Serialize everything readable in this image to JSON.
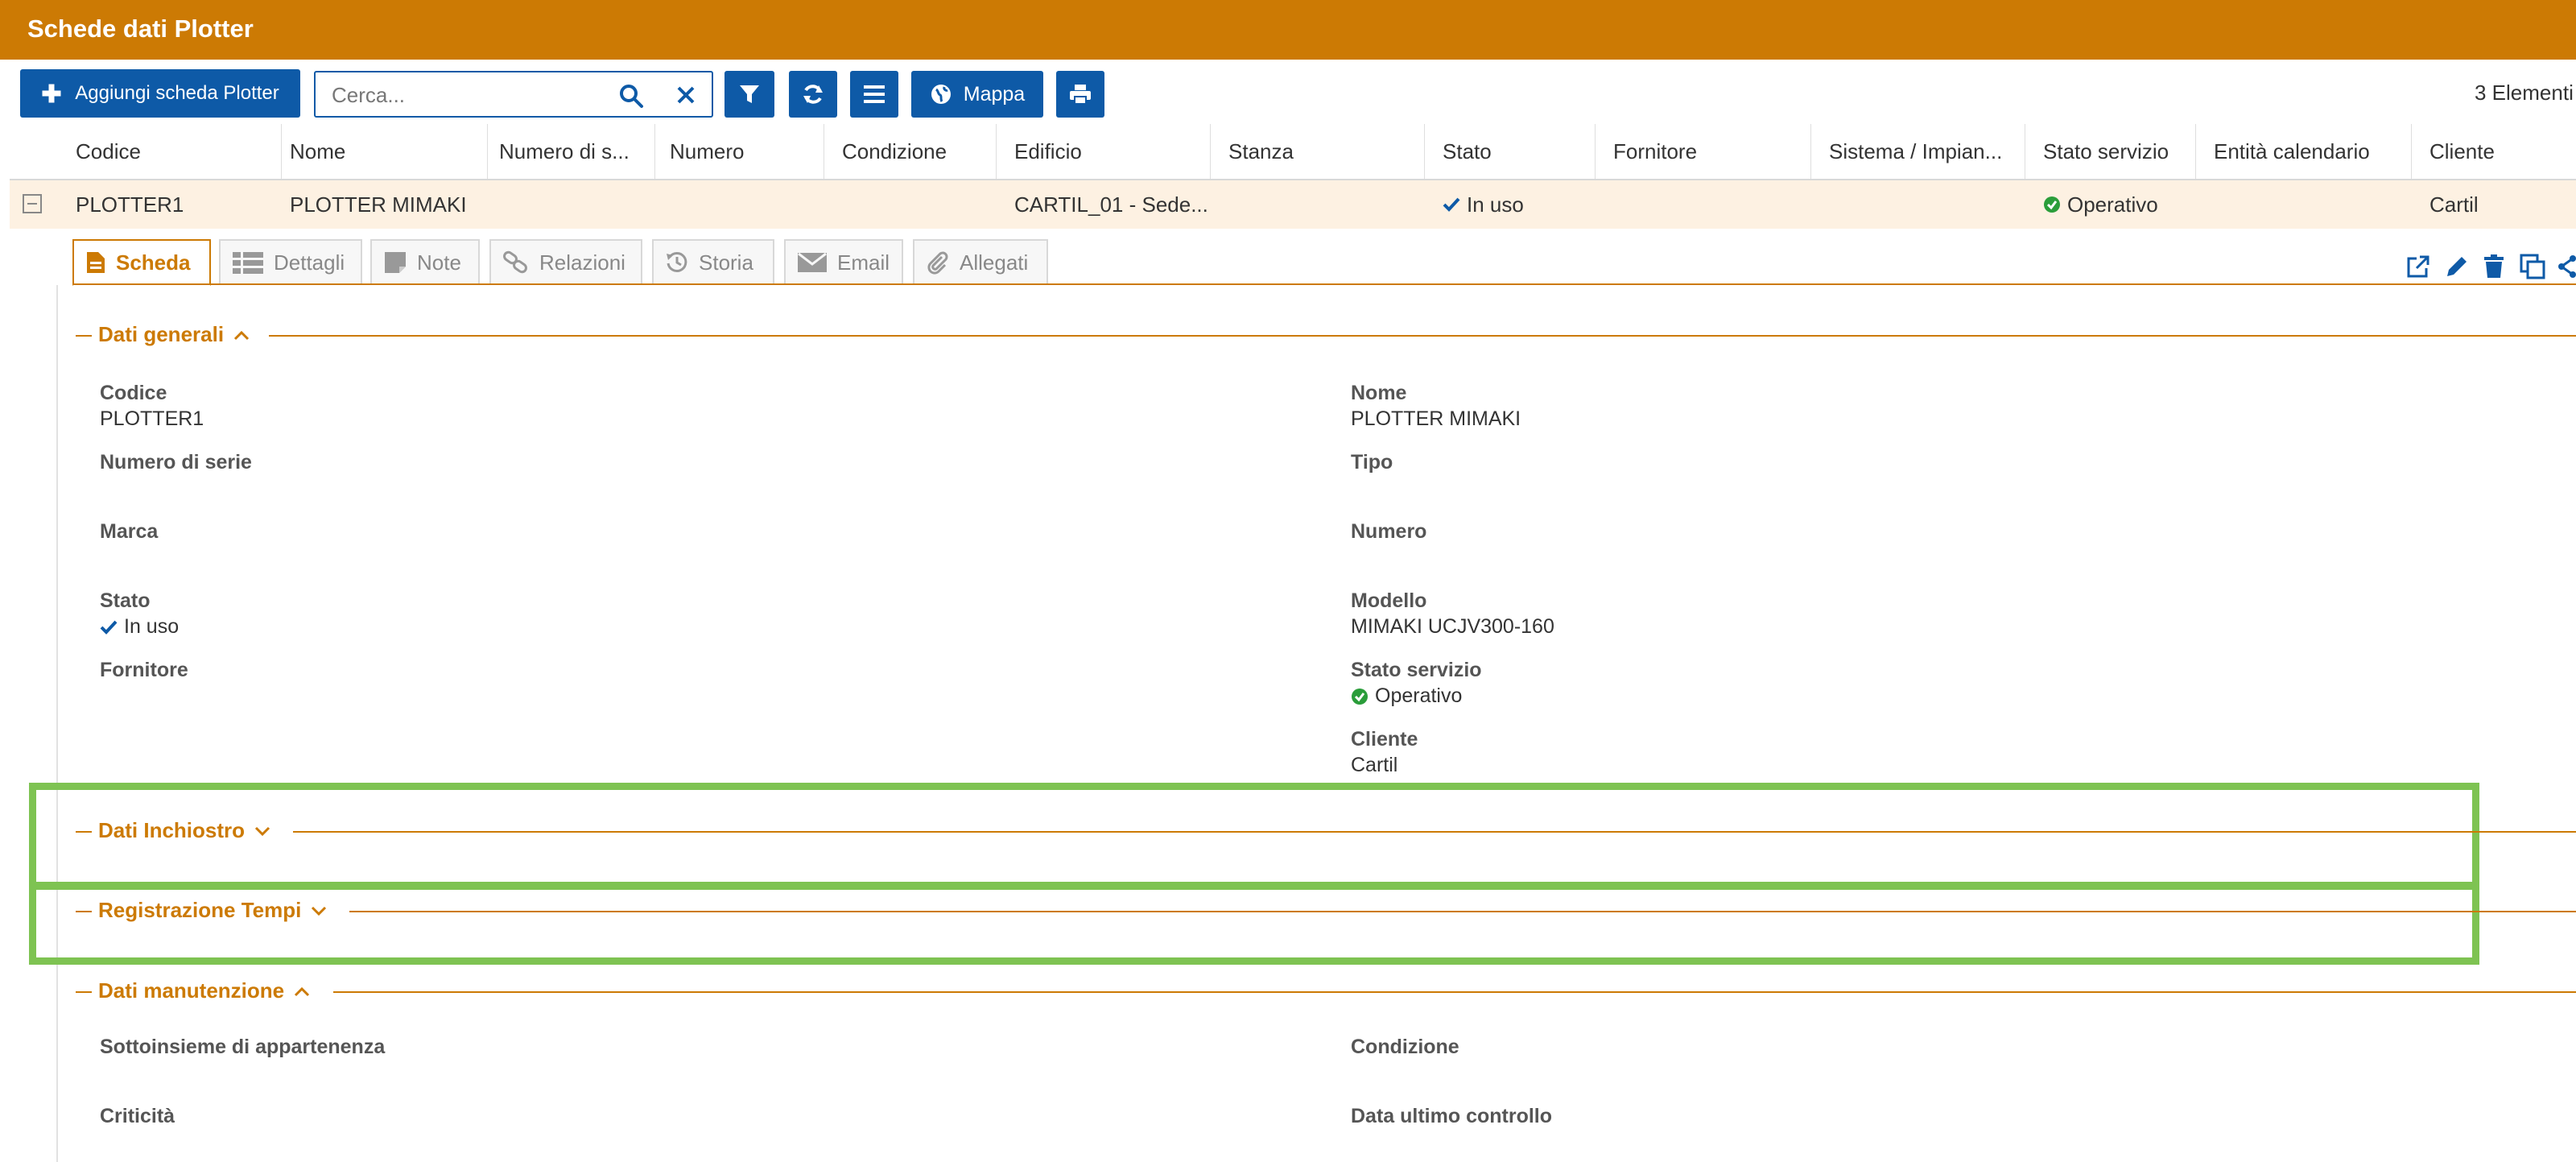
{
  "header": {
    "title": "Schede dati Plotter"
  },
  "toolbar": {
    "add_label": "Aggiungi scheda Plotter",
    "search_placeholder": "Cerca...",
    "search_value": "",
    "map_label": "Mappa",
    "elements_count": "3 Elementi"
  },
  "grid": {
    "columns": [
      "Codice",
      "Nome",
      "Numero di s...",
      "Numero",
      "Condizione",
      "Edificio",
      "Stanza",
      "Stato",
      "Fornitore",
      "Sistema / Impian...",
      "Stato servizio",
      "Entità calendario",
      "Cliente"
    ],
    "row": {
      "codice": "PLOTTER1",
      "nome": "PLOTTER MIMAKI",
      "edificio": "CARTIL_01 - Sede...",
      "stato": "In uso",
      "stato_servizio": "Operativo",
      "cliente": "Cartil"
    }
  },
  "tabs": [
    "Scheda",
    "Dettagli",
    "Note",
    "Relazioni",
    "Storia",
    "Email",
    "Allegati"
  ],
  "sections": {
    "generali": {
      "title": "Dati generali",
      "codice_label": "Codice",
      "codice_value": "PLOTTER1",
      "nome_label": "Nome",
      "nome_value": "PLOTTER MIMAKI",
      "numero_serie_label": "Numero di serie",
      "tipo_label": "Tipo",
      "marca_label": "Marca",
      "numero_label": "Numero",
      "stato_label": "Stato",
      "stato_value": "In uso",
      "modello_label": "Modello",
      "modello_value": "MIMAKI UCJV300-160",
      "fornitore_label": "Fornitore",
      "stato_servizio_label": "Stato servizio",
      "stato_servizio_value": "Operativo",
      "cliente_label": "Cliente",
      "cliente_value": "Cartil"
    },
    "inchiostro": {
      "title": "Dati Inchiostro"
    },
    "tempi": {
      "title": "Registrazione Tempi"
    },
    "manutenzione": {
      "title": "Dati manutenzione",
      "sottoinsieme_label": "Sottoinsieme di appartenenza",
      "condizione_label": "Condizione",
      "criticita_label": "Criticità",
      "data_controllo_label": "Data ultimo controllo"
    }
  },
  "colors": {
    "accent": "#cc7a04",
    "primary": "#0e5aa7",
    "highlight": "#7ec352",
    "row_bg": "#fdf1e2",
    "ok_green": "#2a9d3a"
  }
}
